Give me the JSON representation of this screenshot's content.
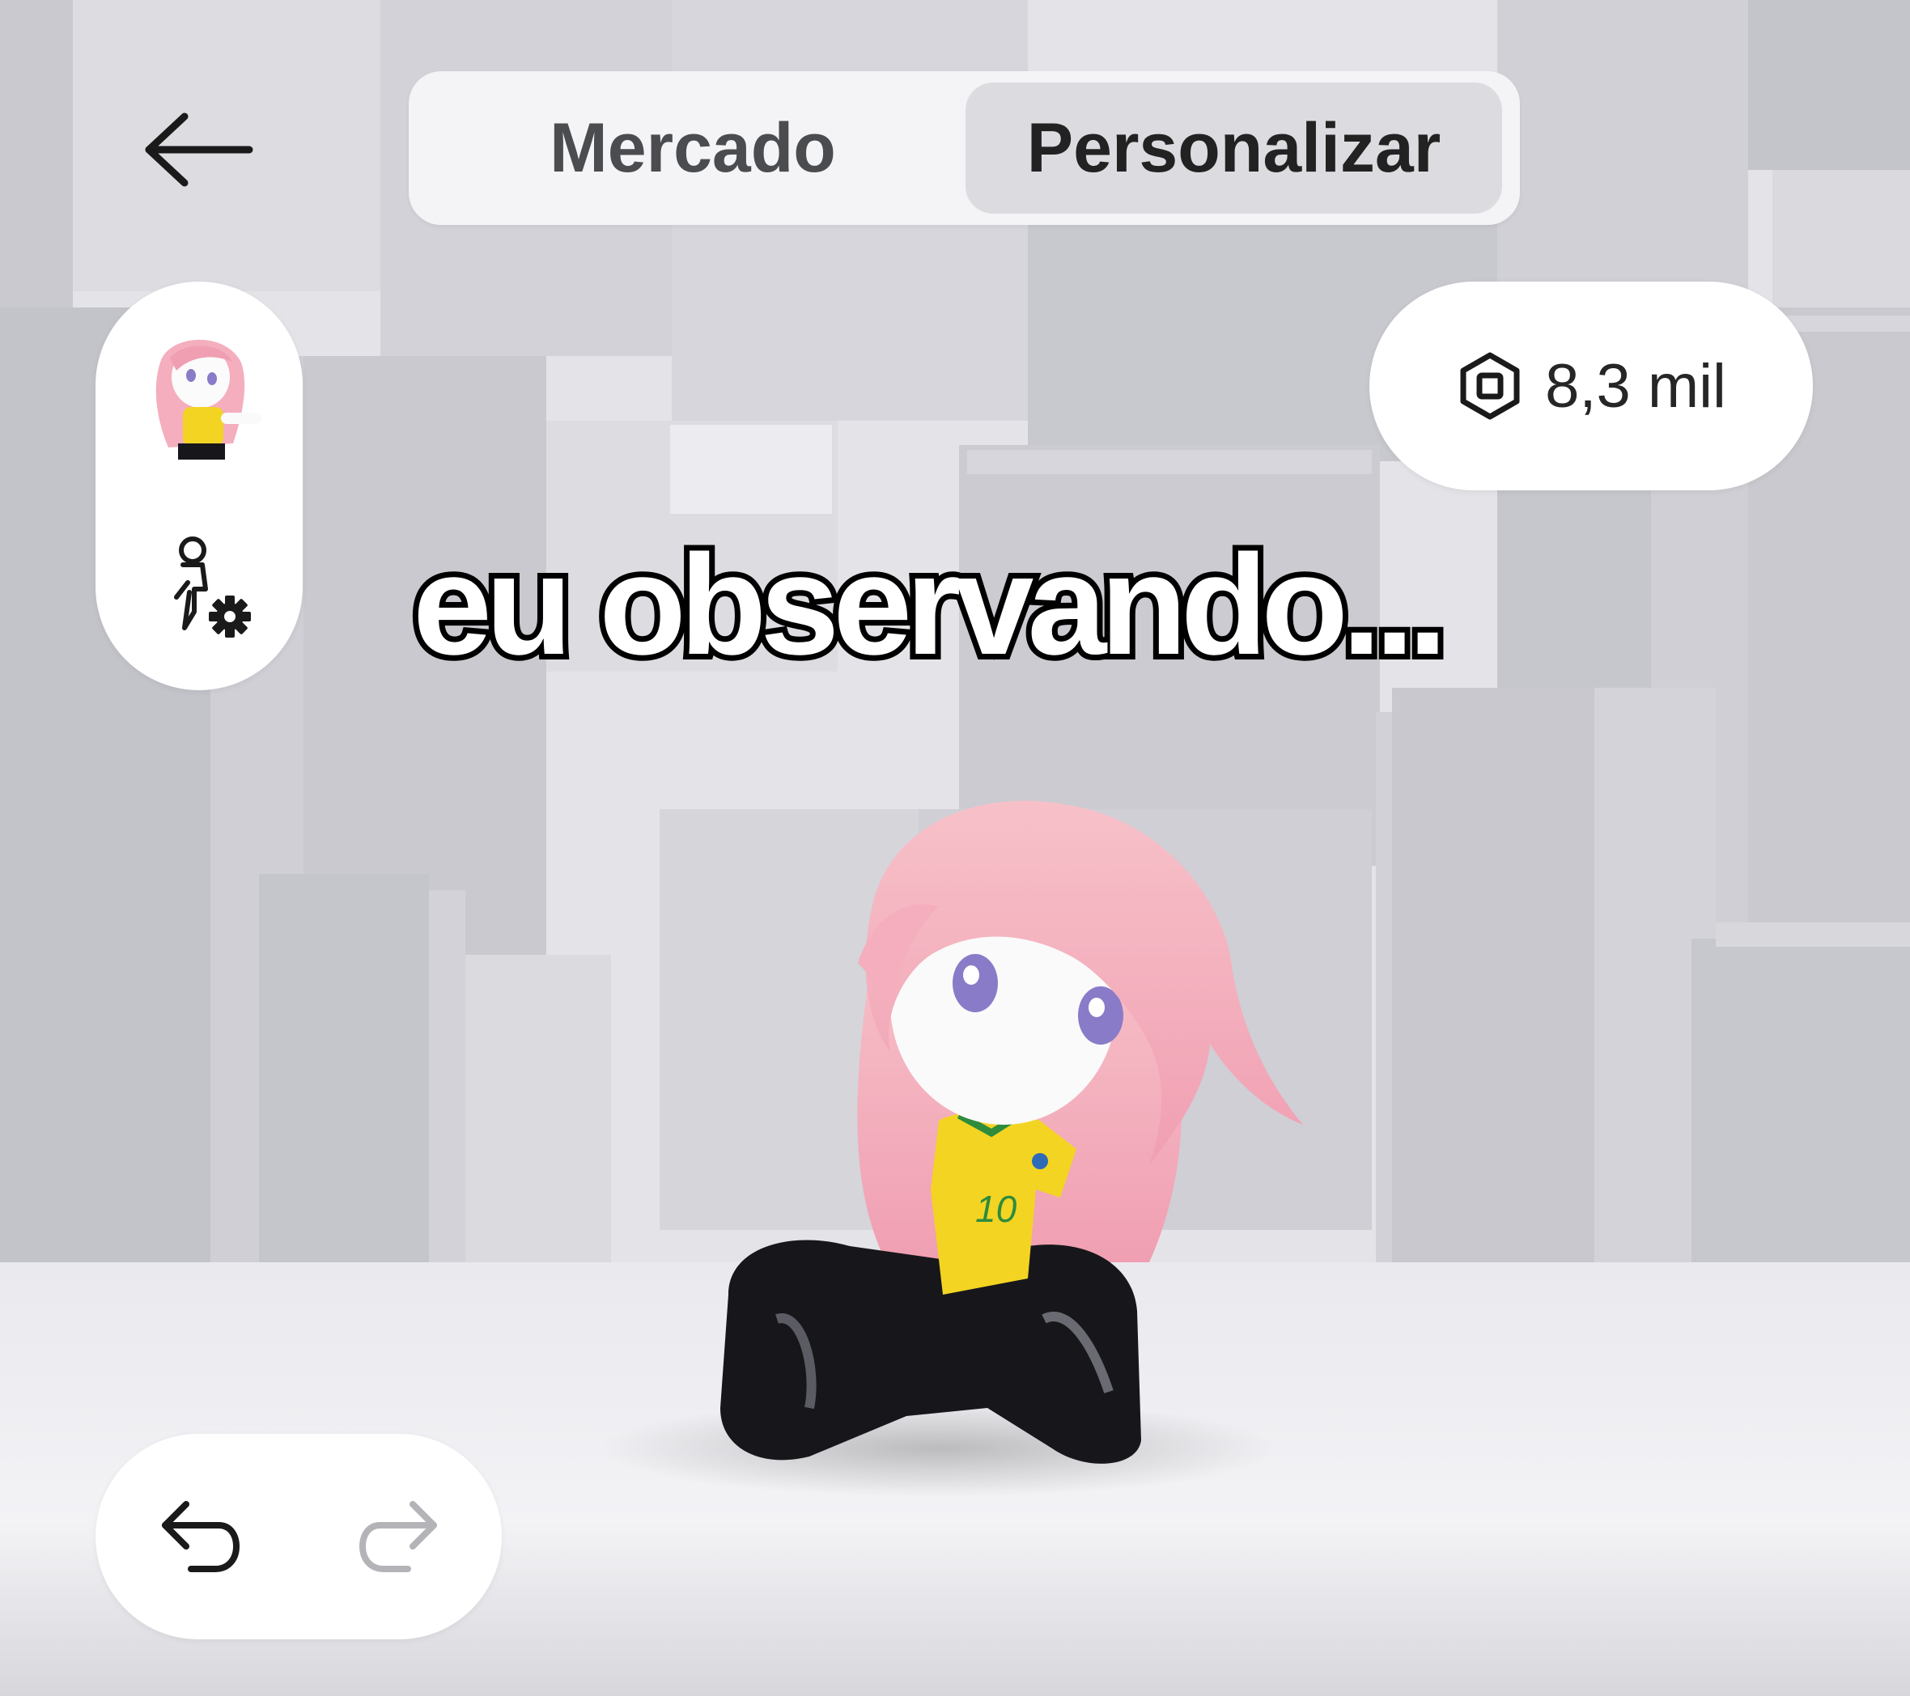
{
  "tabs": {
    "market_label": "Mercado",
    "customize_label": "Personalizar",
    "active": "Personalizar"
  },
  "currency": {
    "icon": "robux-icon",
    "amount": "8,3 mil"
  },
  "caption": {
    "text": "eu observando..."
  },
  "side_panel": {
    "items": [
      {
        "icon": "avatar-thumbnail"
      },
      {
        "icon": "avatar-settings-icon"
      }
    ]
  },
  "history": {
    "undo_icon": "undo-icon",
    "redo_icon": "redo-icon",
    "redo_enabled": false
  },
  "colors": {
    "background": "#e6e6ea",
    "panel": "#ffffff",
    "active_tab": "#dcdce0",
    "caption_fill": "#ffffff",
    "caption_stroke": "#000000",
    "hair": "#f5b6c3",
    "shirt": "#f3d423",
    "pants": "#16161a"
  }
}
